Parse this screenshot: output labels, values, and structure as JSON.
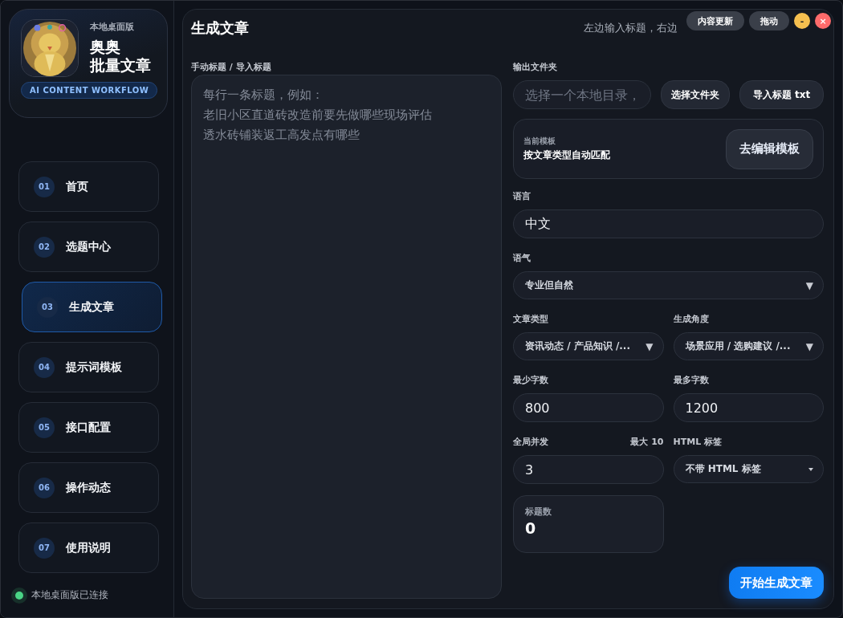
{
  "brand": {
    "edition": "本地桌面版",
    "name_line1": "奥奥",
    "name_line2": "批量文章",
    "tagline": "AI CONTENT WORKFLOW"
  },
  "nav": [
    {
      "number": "01",
      "label": "首页",
      "selected": false
    },
    {
      "number": "02",
      "label": "选题中心",
      "selected": false
    },
    {
      "number": "03",
      "label": "生成文章",
      "selected": true
    },
    {
      "number": "04",
      "label": "提示词模板",
      "selected": false
    },
    {
      "number": "05",
      "label": "接口配置",
      "selected": false
    },
    {
      "number": "06",
      "label": "操作动态",
      "selected": false
    },
    {
      "number": "07",
      "label": "使用说明",
      "selected": false
    }
  ],
  "status": {
    "text": "本地桌面版已连接",
    "connected": true
  },
  "header": {
    "title": "生成文章",
    "subtitle": "左边输入标题，右边"
  },
  "top_controls": {
    "buttons": [
      "内容更新",
      "拖动"
    ],
    "minimize": "-",
    "close": "×"
  },
  "titles_input": {
    "label": "手动标题 / 导入标题",
    "placeholder_lines": [
      "每行一条标题，例如：",
      "老旧小区直道砖改造前要先做哪些现场评估",
      "透水砖铺装返工高发点有哪些"
    ]
  },
  "output_folder": {
    "label": "输出文件夹",
    "placeholder": "选择一个本地目录，",
    "buttons": [
      "选择文件夹",
      "导入标题 txt"
    ]
  },
  "template": {
    "label": "当前模板",
    "value": "按文章类型自动匹配",
    "button": "去编辑模板"
  },
  "rows": [
    [
      {
        "kind": "input",
        "label": "语言",
        "value": "中文"
      }
    ],
    [
      {
        "kind": "select",
        "label": "语气",
        "value": "专业但自然",
        "arrow": "▼"
      }
    ],
    [
      {
        "kind": "select",
        "label": "文章类型",
        "value": "资讯动态 / 产品知识 /...",
        "arrow": "▼"
      },
      {
        "kind": "select",
        "label": "生成角度",
        "value": "场景应用 / 选购建议 /...",
        "arrow": "▼"
      }
    ],
    [
      {
        "kind": "input",
        "label": "最少字数",
        "value": "800"
      },
      {
        "kind": "input",
        "label": "最多字数",
        "value": "1200"
      }
    ],
    [
      {
        "kind": "input",
        "label": "全局并发",
        "hint": "最大 10",
        "value": "3"
      },
      {
        "kind": "dropdown",
        "label": "HTML 标签",
        "value": "不带 HTML 标签"
      }
    ]
  ],
  "title_count": {
    "label": "标题数",
    "value": "0"
  },
  "start_button": "开始生成文章"
}
